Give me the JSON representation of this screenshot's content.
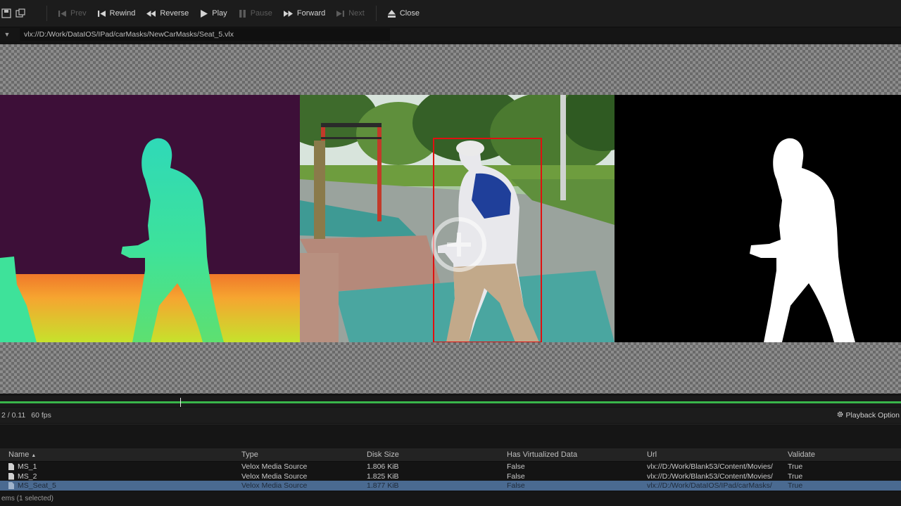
{
  "toolbar": {
    "buttons": [
      {
        "label": "Prev",
        "icon": "prev-icon",
        "enabled": false
      },
      {
        "label": "Rewind",
        "icon": "rewind-icon",
        "enabled": true
      },
      {
        "label": "Reverse",
        "icon": "reverse-icon",
        "enabled": true
      },
      {
        "label": "Play",
        "icon": "play-icon",
        "enabled": true
      },
      {
        "label": "Pause",
        "icon": "pause-icon",
        "enabled": false
      },
      {
        "label": "Forward",
        "icon": "forward-icon",
        "enabled": true
      },
      {
        "label": "Next",
        "icon": "next-icon",
        "enabled": false
      },
      {
        "label": "Close",
        "icon": "eject-icon",
        "enabled": true
      }
    ]
  },
  "media_path": "vlx://D:/Work/DataIOS/IPad/carMasks/NewCarMasks/Seat_5.vlx",
  "timeline": {
    "progress": 0.2,
    "accent_color": "#39b54a"
  },
  "status": {
    "time": "2 / 0.11",
    "fps": "60 fps",
    "playback_options": "Playback Option"
  },
  "assets_table": {
    "columns": [
      "Name",
      "Type",
      "Disk Size",
      "Has Virtualized Data",
      "Url",
      "Validate"
    ],
    "rows": [
      {
        "name": "MS_1",
        "type": "Velox Media Source",
        "disk_size": "1.806 KiB",
        "virtualized": "False",
        "url": "vlx://D:/Work/Blank53/Content/Movies/",
        "validate": "True",
        "selected": false
      },
      {
        "name": "MS_2",
        "type": "Velox Media Source",
        "disk_size": "1.825 KiB",
        "virtualized": "False",
        "url": "vlx://D:/Work/Blank53/Content/Movies/",
        "validate": "True",
        "selected": false
      },
      {
        "name": "MS_Seat_5",
        "type": "Velox Media Source",
        "disk_size": "1.877 KiB",
        "virtualized": "False",
        "url": "vlx://D:/Work/DataIOS/IPad/carMasks/",
        "validate": "True",
        "selected": true
      }
    ]
  },
  "footer_text": "ems (1 selected)",
  "colors": {
    "depth_background": "#3d0f38",
    "bbox": "#e01010",
    "selection": "#4a6a91"
  }
}
